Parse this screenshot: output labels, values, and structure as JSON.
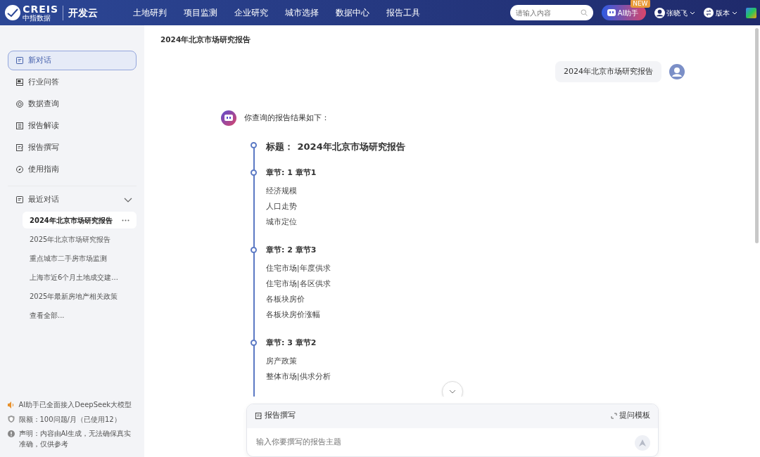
{
  "header": {
    "brand": "CREIS",
    "brand_sub": "中指数据",
    "product": "开发云",
    "nav": [
      {
        "label": "土地研判"
      },
      {
        "label": "项目监测"
      },
      {
        "label": "企业研究"
      },
      {
        "label": "城市选择"
      },
      {
        "label": "数据中心"
      },
      {
        "label": "报告工具"
      }
    ],
    "search": {
      "placeholder": "请输入内容"
    },
    "ai_button": {
      "label": "AI助手",
      "badge": "NEW"
    },
    "user": {
      "name": "张晓飞"
    },
    "version": {
      "label": "版本"
    }
  },
  "sidebar": {
    "menu": [
      {
        "label": "新对话",
        "selected": true
      },
      {
        "label": "行业问答",
        "selected": false
      },
      {
        "label": "数据查询",
        "selected": false
      },
      {
        "label": "报告解读",
        "selected": false
      },
      {
        "label": "报告撰写",
        "selected": false
      },
      {
        "label": "使用指南",
        "selected": false
      }
    ],
    "recent": {
      "label": "最近对话",
      "expanded": true,
      "items": [
        {
          "label": "2024年北京市场研究报告",
          "selected": true
        },
        {
          "label": "2025年北京市场研究报告",
          "selected": false
        },
        {
          "label": "重点城市二手房市场监测",
          "selected": false
        },
        {
          "label": "上海市近6个月土地成交建...",
          "selected": false
        },
        {
          "label": "2025年最新房地产相关政策",
          "selected": false
        }
      ],
      "more": "查看全部..."
    },
    "notices": [
      {
        "text": "AI助手已全面接入DeepSeek大模型"
      },
      {
        "text": "限额：100问题/月（已使用12）"
      },
      {
        "text": "声明：内容由AI生成，无法确保真实准确，仅供参考"
      }
    ]
  },
  "main": {
    "title": "2024年北京市场研究报告",
    "user_message": "2024年北京市场研究报告",
    "bot": {
      "intro": "你查询的报告结果如下：",
      "outline": [
        {
          "kind": "title",
          "label": "标题：",
          "value": "2024年北京市场研究报告"
        },
        {
          "kind": "chapter",
          "label": "章节: 1 章节1",
          "items": [
            "经济规模",
            "人口走势",
            "城市定位"
          ]
        },
        {
          "kind": "chapter",
          "label": "章节: 2 章节3",
          "items": [
            "住宅市场|年度供求",
            "住宅市场|各区供求",
            "各板块房价",
            "各板块房价涨幅"
          ]
        },
        {
          "kind": "chapter",
          "label": "章节: 3 章节2",
          "items": [
            "房产政策",
            "整体市场|供求分析"
          ]
        }
      ]
    },
    "composer": {
      "mode": "报告撰写",
      "template": "提问模板",
      "placeholder": "输入你要撰写的报告主题"
    }
  }
}
